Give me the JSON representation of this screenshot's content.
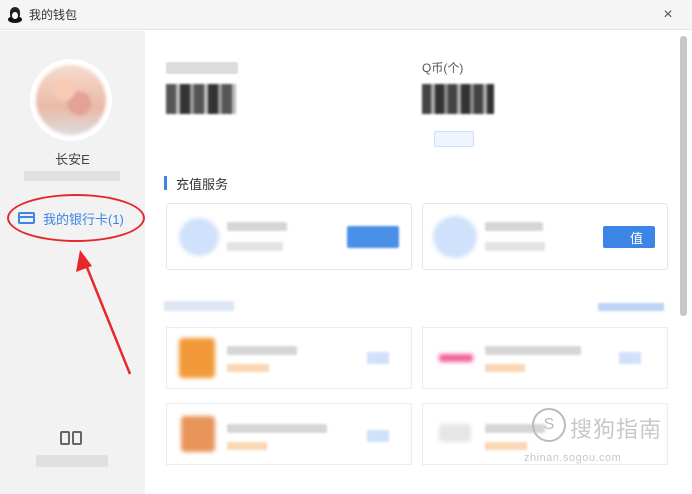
{
  "window": {
    "title": "我的钱包",
    "close_glyph": "×"
  },
  "sidebar": {
    "username": "长安E",
    "bank_card_label": "我的银行卡(1)"
  },
  "main": {
    "qb_label": "Q币(个)",
    "recharge_section_title": "充值服务",
    "recharge_button_label": "值"
  },
  "watermark": {
    "text": "搜狗指南",
    "url": "zhinan.sogou.com"
  },
  "colors": {
    "accent": "#3c84e6",
    "annotation": "#e8272b"
  },
  "icons": {
    "app": "qq-penguin-icon",
    "bank_card": "bank-card-icon",
    "close": "close-icon"
  }
}
